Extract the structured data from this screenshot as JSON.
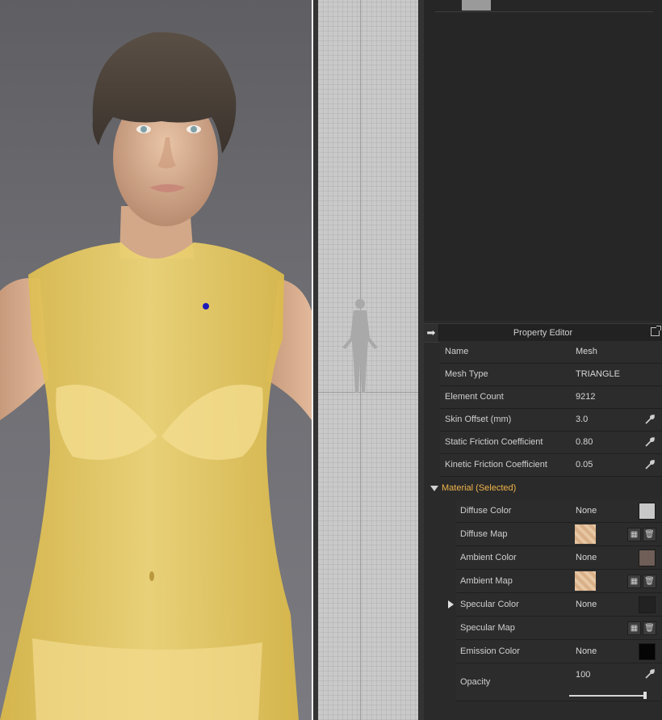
{
  "property_editor": {
    "title": "Property Editor",
    "rows": [
      {
        "label": "Name",
        "value": "Mesh",
        "editable": false
      },
      {
        "label": "Mesh Type",
        "value": "TRIANGLE",
        "editable": false
      },
      {
        "label": "Element Count",
        "value": "9212",
        "editable": false
      },
      {
        "label": "Skin Offset (mm)",
        "value": "3.0",
        "editable": true
      },
      {
        "label": "Static Friction Coefficient",
        "value": "0.80",
        "editable": true
      },
      {
        "label": "Kinetic Friction Coefficient",
        "value": "0.05",
        "editable": true
      }
    ],
    "material": {
      "section_label": "Material (Selected)",
      "diffuse_color": {
        "label": "Diffuse Color",
        "value": "None",
        "swatch": "#c8c8c8"
      },
      "diffuse_map": {
        "label": "Diffuse Map"
      },
      "ambient_color": {
        "label": "Ambient Color",
        "value": "None",
        "swatch": "#6e5e57"
      },
      "ambient_map": {
        "label": "Ambient Map"
      },
      "specular_color": {
        "label": "Specular Color",
        "value": "None",
        "swatch": "#222222"
      },
      "specular_map": {
        "label": "Specular Map"
      },
      "emission_color": {
        "label": "Emission Color",
        "value": "None",
        "swatch": "#050505"
      },
      "opacity": {
        "label": "Opacity",
        "value": "100",
        "fraction": 1.0
      }
    }
  },
  "colors": {
    "accent": "#f0b44a",
    "panel_bg": "#2c2c2c",
    "garment": "#e8c85a"
  }
}
